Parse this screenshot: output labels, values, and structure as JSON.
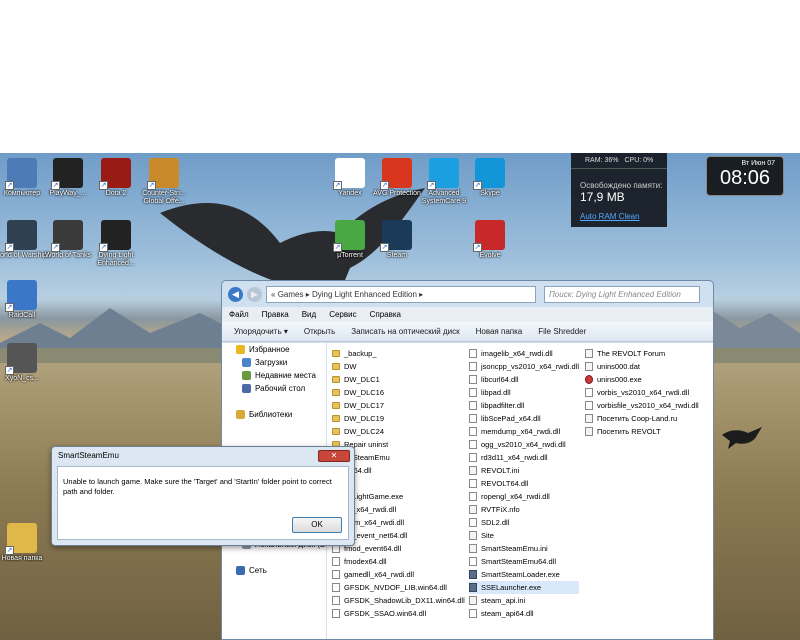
{
  "desktop_icons": [
    {
      "label": "Компьютер",
      "color": "#4d7bb8",
      "glyph": "computer-icon"
    },
    {
      "label": "PlayWay_...",
      "color": "#222222",
      "glyph": "pw-icon"
    },
    {
      "label": "Dota 2",
      "color": "#9a1a14",
      "glyph": "dota-icon"
    },
    {
      "label": "Counter-Stri... Global Offe...",
      "color": "#c88a2a",
      "glyph": "csgo-icon"
    },
    {
      "label": "World of Warships",
      "color": "#2f4050",
      "glyph": "warships-icon"
    },
    {
      "label": "World of Tanks",
      "color": "#3a3a3a",
      "glyph": "tanks-icon"
    },
    {
      "label": "Dying Light Enhanced...",
      "color": "#222222",
      "glyph": "dying-light-icon"
    },
    {
      "label": "RaidCall",
      "color": "#3b77c9",
      "glyph": "raidcall-icon"
    },
    {
      "label": "XyoN_cs...",
      "color": "#555555",
      "glyph": "xyon-icon"
    },
    {
      "label": "Новая папка",
      "color": "#e0b84a",
      "glyph": "folder-icon"
    },
    {
      "label": "Yandex",
      "color": "#ffffff",
      "glyph": "yandex-icon"
    },
    {
      "label": "AVG Protection",
      "color": "#d8361f",
      "glyph": "avg-icon"
    },
    {
      "label": "Advanced SystemCare 9",
      "color": "#1aa0e0",
      "glyph": "asc-icon"
    },
    {
      "label": "Skype",
      "color": "#1296d8",
      "glyph": "skype-icon"
    },
    {
      "label": "µTorrent",
      "color": "#4aa844",
      "glyph": "utorrent-icon"
    },
    {
      "label": "Steam",
      "color": "#1b3a5a",
      "glyph": "steam-icon"
    },
    {
      "label": "Evolve",
      "color": "#c8282a",
      "glyph": "evolve-icon"
    }
  ],
  "ram_widget": {
    "ram": "RAM: 36%",
    "cpu": "CPU: 0%",
    "freed_label": "Освобождено памяти:",
    "freed_value": "17,9 MB",
    "link": "Auto RAM Clean"
  },
  "clock": {
    "date": "Вт Июн 07",
    "time": "08:06"
  },
  "explorer": {
    "path_root": "«",
    "path": [
      "Games",
      "Dying Light Enhanced Edition"
    ],
    "search_placeholder": "Поиск: Dying Light Enhanced Edition",
    "menu": [
      "Файл",
      "Правка",
      "Вид",
      "Сервис",
      "Справка"
    ],
    "toolbar": [
      "Упорядочить ▾",
      "Открыть",
      "Записать на оптический диск",
      "Новая папка",
      "File Shredder"
    ],
    "nav_items": [
      {
        "label": "Избранное",
        "color": "#e8b820"
      },
      {
        "label": "Загрузки",
        "color": "#4a86c8"
      },
      {
        "label": "Недавние места",
        "color": "#6a9a40"
      },
      {
        "label": "Рабочий стол",
        "color": "#4a6aa8"
      },
      {
        "label": "",
        "color": "transparent"
      },
      {
        "label": "Библиотеки",
        "color": "#d8a838"
      },
      {
        "label": "",
        "color": "transparent"
      },
      {
        "label": "",
        "color": "transparent"
      },
      {
        "label": "",
        "color": "transparent"
      },
      {
        "label": "",
        "color": "transparent"
      },
      {
        "label": "",
        "color": "transparent"
      },
      {
        "label": "",
        "color": "transparent"
      },
      {
        "label": "",
        "color": "transparent"
      },
      {
        "label": "",
        "color": "transparent"
      },
      {
        "label": "Локальный диск (C",
        "color": "#8a9aa8"
      },
      {
        "label": "Локальный диск (D",
        "color": "#8a9aa8"
      },
      {
        "label": "",
        "color": "transparent"
      },
      {
        "label": "Сеть",
        "color": "#3a6ab0"
      }
    ],
    "columns": [
      [
        {
          "name": "_backup_",
          "type": "folder"
        },
        {
          "name": "DW",
          "type": "folder"
        },
        {
          "name": "DW_DLC1",
          "type": "folder"
        },
        {
          "name": "DW_DLC16",
          "type": "folder"
        },
        {
          "name": "DW_DLC17",
          "type": "folder"
        },
        {
          "name": "DW_DLC19",
          "type": "folder"
        },
        {
          "name": "DW_DLC24",
          "type": "folder"
        },
        {
          "name": "Repair uninst",
          "type": "folder"
        },
        {
          "name": "artSteamEmu",
          "type": "folder"
        },
        {
          "name": "2w64.dll",
          "type": "dll"
        },
        {
          "name": "dll",
          "type": "dll"
        },
        {
          "name": "ngLightGame.exe",
          "type": "exe"
        },
        {
          "name": "ne_x64_rwdi.dll",
          "type": "dll"
        },
        {
          "name": "stem_x64_rwdi.dll",
          "type": "dll"
        },
        {
          "name": "od_event_net64.dll",
          "type": "dll"
        },
        {
          "name": "fmod_event64.dll",
          "type": "dll"
        },
        {
          "name": "fmodex64.dll",
          "type": "dll"
        },
        {
          "name": "gamedll_x64_rwdi.dll",
          "type": "dll"
        },
        {
          "name": "GFSDK_NVDOF_LIB.win64.dll",
          "type": "dll"
        },
        {
          "name": "GFSDK_ShadowLib_DX11.win64.dll",
          "type": "dll"
        },
        {
          "name": "GFSDK_SSAO.win64.dll",
          "type": "dll"
        }
      ],
      [
        {
          "name": "imagelib_x64_rwdi.dll",
          "type": "dll"
        },
        {
          "name": "jsoncpp_vs2010_x64_rwdi.dll",
          "type": "dll"
        },
        {
          "name": "libcurl64.dll",
          "type": "dll"
        },
        {
          "name": "libpad.dll",
          "type": "dll"
        },
        {
          "name": "libpadfilter.dll",
          "type": "dll"
        },
        {
          "name": "libScePad_x64.dll",
          "type": "dll"
        },
        {
          "name": "memdump_x64_rwdi.dll",
          "type": "dll"
        },
        {
          "name": "ogg_vs2010_x64_rwdi.dll",
          "type": "dll"
        },
        {
          "name": "rd3d11_x64_rwdi.dll",
          "type": "dll"
        },
        {
          "name": "REVOLT.ini",
          "type": "dat"
        },
        {
          "name": "REVOLT64.dll",
          "type": "dll"
        },
        {
          "name": "ropengl_x64_rwdi.dll",
          "type": "dll"
        },
        {
          "name": "RVTFiX.nfo",
          "type": "dat"
        },
        {
          "name": "SDL2.dll",
          "type": "dll"
        },
        {
          "name": "Site",
          "type": "dat"
        },
        {
          "name": "SmartSteamEmu.ini",
          "type": "dat"
        },
        {
          "name": "SmartSteamEmu64.dll",
          "type": "dll"
        },
        {
          "name": "SmartSteamLoader.exe",
          "type": "exe"
        },
        {
          "name": "SSELauncher.exe",
          "type": "exe",
          "selected": true
        },
        {
          "name": "steam_api.ini",
          "type": "dat"
        },
        {
          "name": "steam_api64.dll",
          "type": "dll"
        }
      ],
      [
        {
          "name": "The REVOLT Forum",
          "type": "dat"
        },
        {
          "name": "unins000.dat",
          "type": "dat"
        },
        {
          "name": "unins000.exe",
          "type": "red"
        },
        {
          "name": "vorbis_vs2010_x64_rwdi.dll",
          "type": "dll"
        },
        {
          "name": "vorbisfile_vs2010_x64_rwdi.dll",
          "type": "dll"
        },
        {
          "name": "Посетить Coop-Land.ru",
          "type": "dat"
        },
        {
          "name": "Посетить REVOLT",
          "type": "dat"
        }
      ]
    ]
  },
  "dialog": {
    "title": "SmartSteamEmu",
    "close": "✕",
    "message": "Unable to launch game. Make sure the 'Target' and 'StartIn' folder point to correct path and folder.",
    "ok": "OK"
  }
}
